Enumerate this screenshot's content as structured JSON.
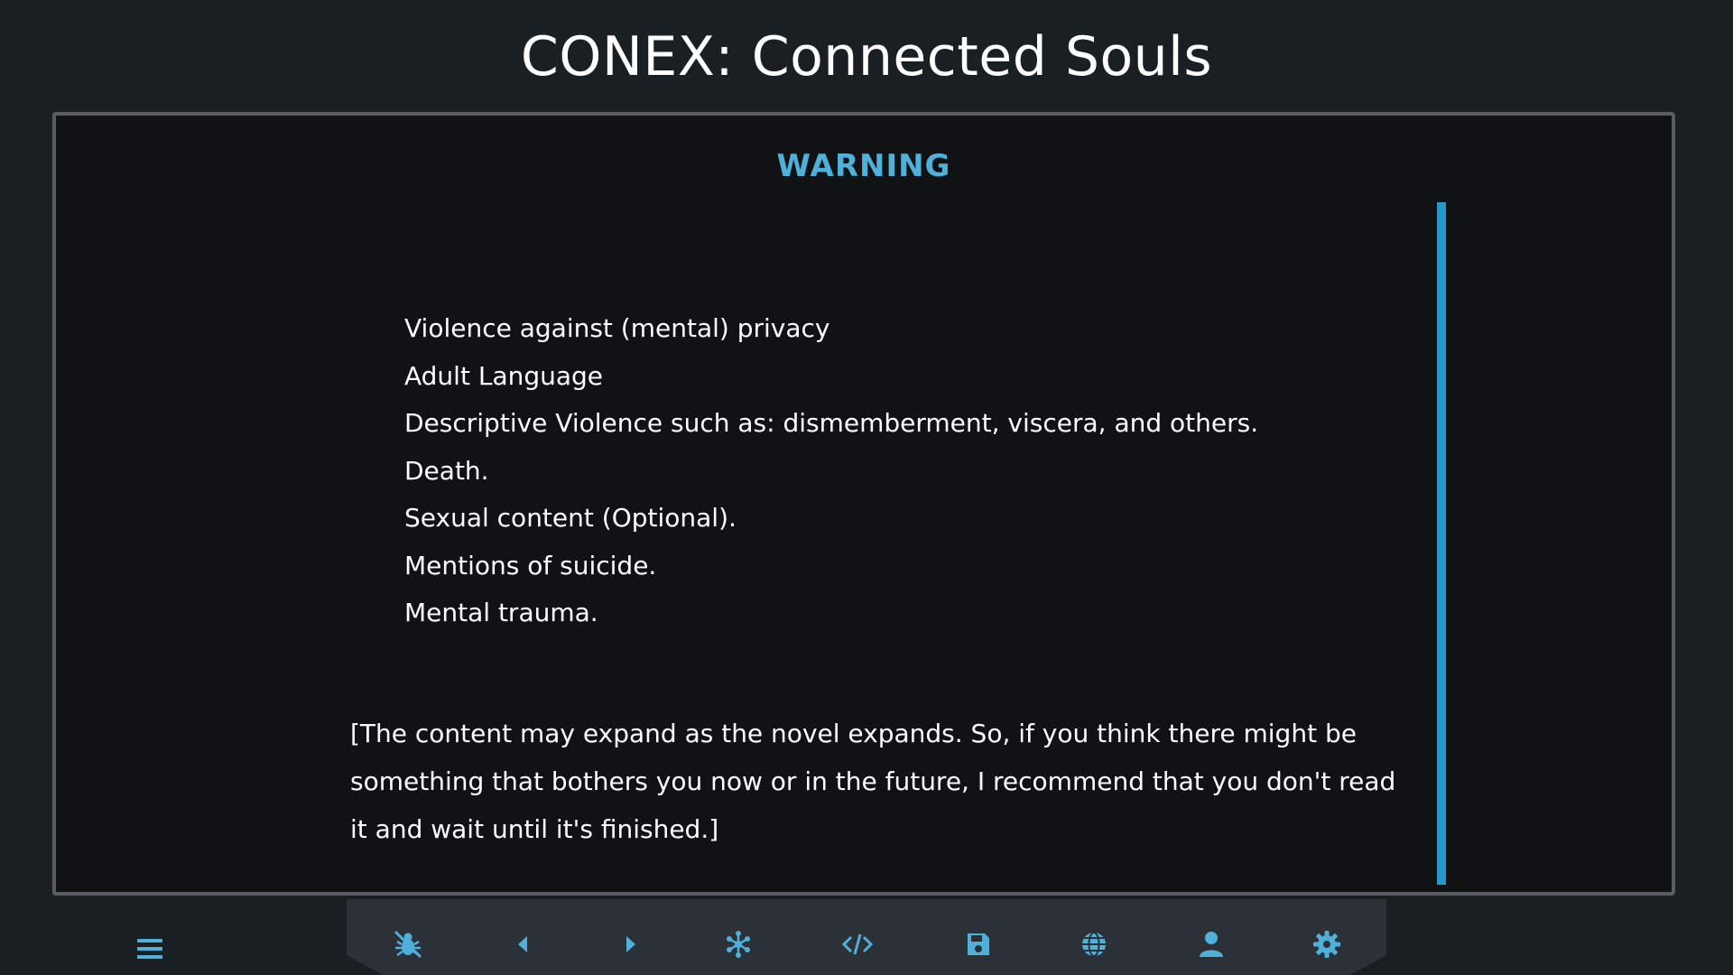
{
  "app": {
    "title": "CONEX: Connected Souls"
  },
  "warning": {
    "heading": "WARNING",
    "items": [
      "Violence against (mental) privacy",
      "Adult Language",
      "Descriptive Violence such as: dismemberment, viscera, and others.",
      "Death.",
      "Sexual content (Optional).",
      "Mentions of suicide.",
      "Mental trauma."
    ],
    "note": "[The content may expand as the novel expands. So, if you think there might be something that bothers you now or in the future, I recommend that you don't read it and wait until it's finished.]"
  },
  "toolbar": {
    "icons": [
      "menu-icon",
      "bug-icon",
      "caret-left-icon",
      "caret-right-icon",
      "network-icon",
      "code-icon",
      "save-icon",
      "globe-icon",
      "user-icon",
      "gear-icon"
    ]
  },
  "colors": {
    "background": "#1a1f24",
    "panel": "#111213",
    "panel_border": "#5a5e63",
    "accent": "#4fb0da",
    "scrollbar": "#2599c9",
    "toolbar": "#2b3137",
    "text": "#ffffff"
  }
}
